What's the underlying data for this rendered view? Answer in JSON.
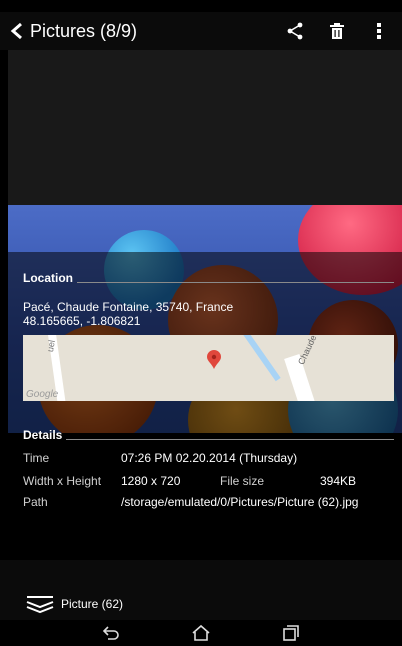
{
  "appbar": {
    "title": "Pictures (8/9)",
    "back_icon": "chevron-left-icon",
    "share_icon": "share-icon",
    "delete_icon": "trash-icon",
    "more_icon": "more-vert-icon"
  },
  "location": {
    "heading": "Location",
    "address": "Pacé, Chaude Fontaine, 35740, France",
    "coordinates": "48.165665, -1.806821",
    "map_label_street": "Chaude Fontaine",
    "map_label_google": "Google",
    "map_label_small": "uel"
  },
  "details": {
    "heading": "Details",
    "time_label": "Time",
    "time_value": "07:26 PM 02.20.2014 (Thursday)",
    "wh_label": "Width x Height",
    "wh_value": "1280 x 720",
    "filesize_label": "File size",
    "filesize_value": "394KB",
    "path_label": "Path",
    "path_value": "/storage/emulated/0/Pictures/Picture (62).jpg"
  },
  "footer": {
    "file_name": "Picture (62)"
  },
  "navbar": {
    "back": "back-icon",
    "home": "home-icon",
    "recents": "recents-icon"
  }
}
